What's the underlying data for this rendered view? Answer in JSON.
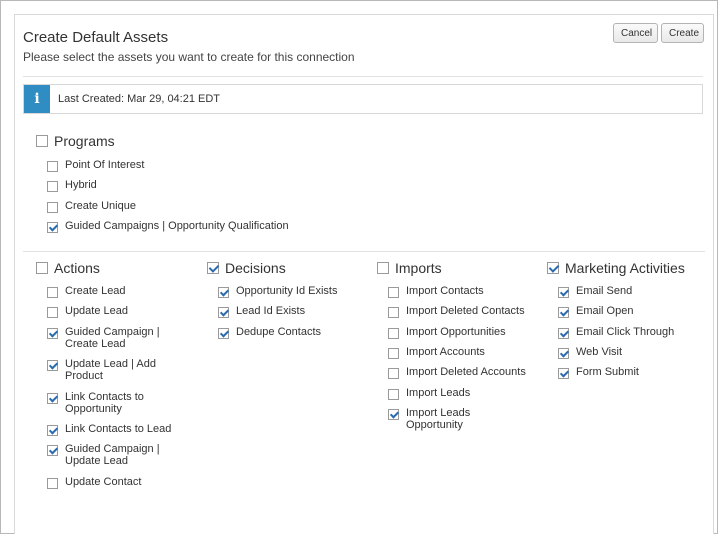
{
  "dialog": {
    "title": "Create Default Assets",
    "subtitle": "Please select the assets you want to create for this connection",
    "cancel_label": "Cancel",
    "create_label": "Create"
  },
  "info": {
    "icon": "info-icon",
    "glyph": "i",
    "text": "Last Created: Mar 29, 04:21 EDT"
  },
  "programs": {
    "label": "Programs",
    "checked": false,
    "items": [
      {
        "label": "Point Of Interest",
        "checked": false
      },
      {
        "label": "Hybrid",
        "checked": false
      },
      {
        "label": "Create Unique",
        "checked": false
      },
      {
        "label": "Guided Campaigns | Opportunity Qualification",
        "checked": true
      }
    ]
  },
  "groups": [
    {
      "key": "actions",
      "label": "Actions",
      "checked": false,
      "items": [
        {
          "label": "Create Lead",
          "checked": false
        },
        {
          "label": "Update Lead",
          "checked": false
        },
        {
          "label": "Guided Campaign |\nCreate Lead",
          "checked": true
        },
        {
          "label": "Update Lead | Add\nProduct",
          "checked": true
        },
        {
          "label": "Link Contacts to\nOpportunity",
          "checked": true
        },
        {
          "label": "Link Contacts to Lead",
          "checked": true
        },
        {
          "label": "Guided Campaign |\nUpdate Lead",
          "checked": true
        },
        {
          "label": "Update Contact",
          "checked": false
        }
      ]
    },
    {
      "key": "decisions",
      "label": "Decisions",
      "checked": true,
      "items": [
        {
          "label": "Opportunity Id Exists",
          "checked": true
        },
        {
          "label": "Lead Id Exists",
          "checked": true
        },
        {
          "label": "Dedupe Contacts",
          "checked": true
        }
      ]
    },
    {
      "key": "imports",
      "label": "Imports",
      "checked": false,
      "items": [
        {
          "label": "Import Contacts",
          "checked": false
        },
        {
          "label": "Import Deleted Contacts",
          "checked": false
        },
        {
          "label": "Import Opportunities",
          "checked": false
        },
        {
          "label": "Import Accounts",
          "checked": false
        },
        {
          "label": "Import Deleted Accounts",
          "checked": false
        },
        {
          "label": "Import Leads",
          "checked": false
        },
        {
          "label": "Import Leads\nOpportunity",
          "checked": true
        }
      ]
    },
    {
      "key": "marketing-activities",
      "label": "Marketing Activities",
      "checked": true,
      "items": [
        {
          "label": "Email Send",
          "checked": true
        },
        {
          "label": "Email Open",
          "checked": true
        },
        {
          "label": "Email Click Through",
          "checked": true
        },
        {
          "label": "Web Visit",
          "checked": true
        },
        {
          "label": "Form Submit",
          "checked": true
        }
      ]
    }
  ]
}
